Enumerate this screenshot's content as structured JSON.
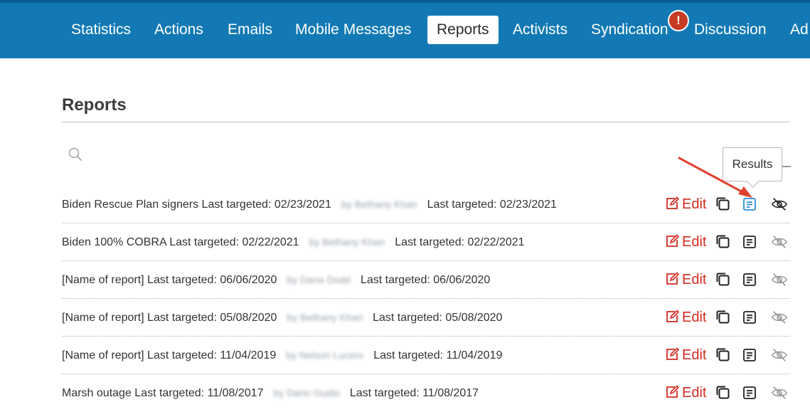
{
  "nav": {
    "items": [
      {
        "label": "Statistics",
        "active": false
      },
      {
        "label": "Actions",
        "active": false
      },
      {
        "label": "Emails",
        "active": false
      },
      {
        "label": "Mobile Messages",
        "active": false
      },
      {
        "label": "Reports",
        "active": true
      },
      {
        "label": "Activists",
        "active": false
      },
      {
        "label": "Syndication",
        "active": false
      },
      {
        "label": "Discussion",
        "active": false
      },
      {
        "label": "Ad",
        "active": false
      }
    ],
    "alert_badge": "!"
  },
  "page": {
    "title": "Reports",
    "tooltip": "Results"
  },
  "rows": [
    {
      "name": "Biden Rescue Plan signers Last targeted: 02/23/2021",
      "author": "by Bethany Khan",
      "targeted": "Last targeted: 02/23/2021",
      "edit": "Edit"
    },
    {
      "name": "Biden 100% COBRA Last targeted: 02/22/2021",
      "author": "by Bethany Khan",
      "targeted": "Last targeted: 02/22/2021",
      "edit": "Edit"
    },
    {
      "name": "[Name of report] Last targeted: 06/06/2020",
      "author": "by Dana Dodd",
      "targeted": "Last targeted: 06/06/2020",
      "edit": "Edit"
    },
    {
      "name": "[Name of report] Last targeted: 05/08/2020",
      "author": "by Bethany Khan",
      "targeted": "Last targeted: 05/08/2020",
      "edit": "Edit"
    },
    {
      "name": "[Name of report] Last targeted: 11/04/2019",
      "author": "by Nelson Lucero",
      "targeted": "Last targeted: 11/04/2019",
      "edit": "Edit"
    },
    {
      "name": "Marsh outage Last targeted: 11/08/2017",
      "author": "by Dario Guido",
      "targeted": "Last targeted: 11/08/2017",
      "edit": "Edit"
    }
  ],
  "colors": {
    "topbar": "#1279b4",
    "edit": "#d22a20",
    "results_active": "#2a8fd6",
    "icon_default": "#222222",
    "annotation_arrow": "#e0402e"
  },
  "icons": {
    "search": "search-icon",
    "edit": "edit-icon",
    "copy": "copy-icon",
    "results": "results-icon",
    "hide": "eye-slash-icon",
    "alert": "alert-icon"
  }
}
